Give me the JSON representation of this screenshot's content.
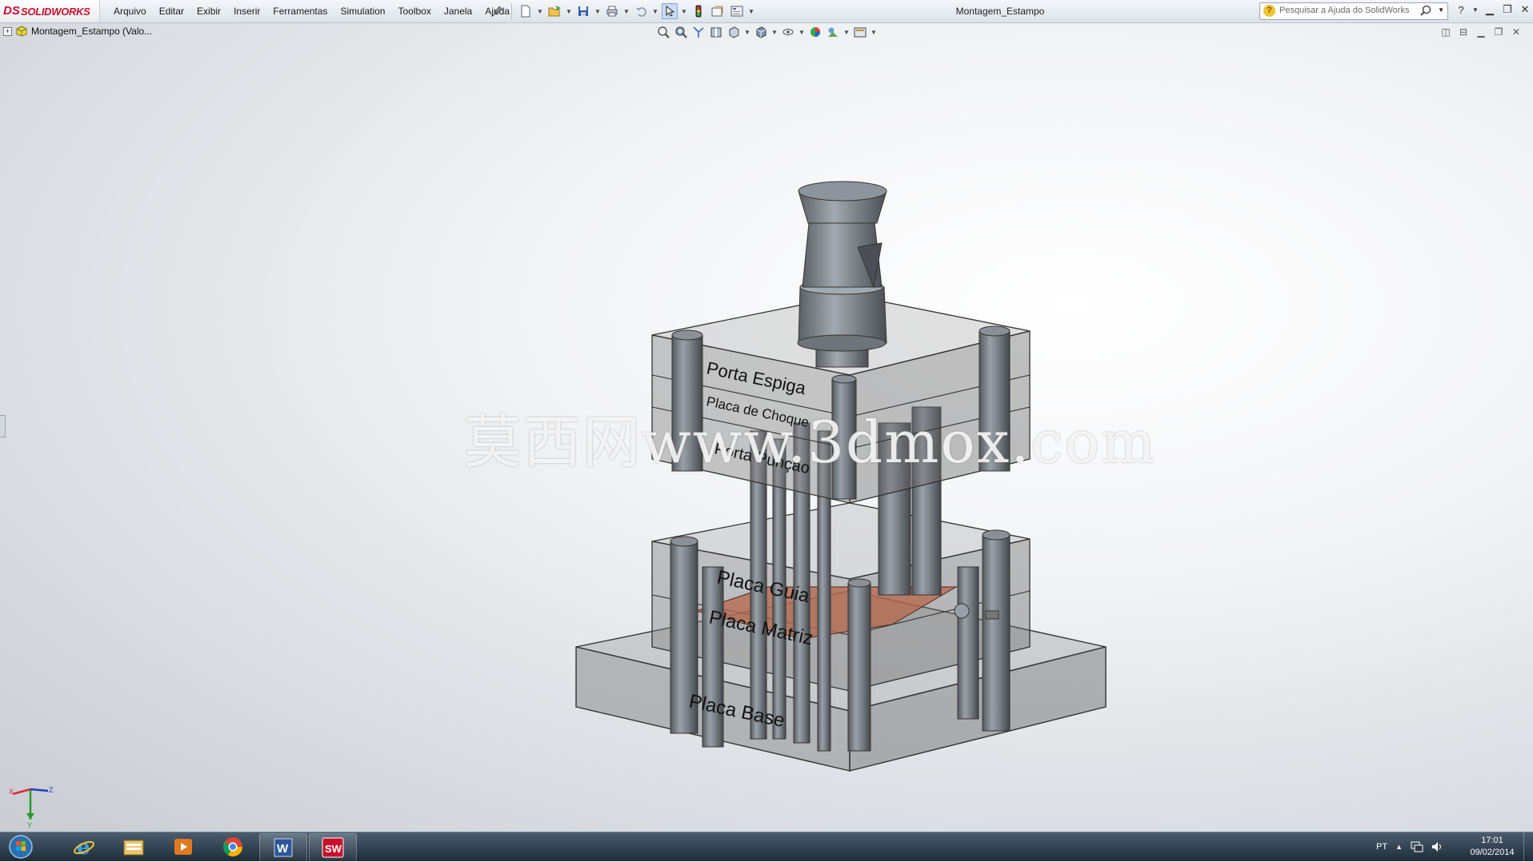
{
  "app": {
    "logo_prefix": "DS",
    "logo_name": "SOLIDWORKS"
  },
  "menu": [
    "Arquivo",
    "Editar",
    "Exibir",
    "Inserir",
    "Ferramentas",
    "Simulation",
    "Toolbox",
    "Janela",
    "Ajuda"
  ],
  "document": {
    "title": "Montagem_Estampo"
  },
  "search": {
    "placeholder": "Pesquisar a Ajuda do SolidWorks"
  },
  "feature_tree": {
    "root_label": "Montagem_Estampo  (Valo..."
  },
  "model_labels": {
    "porta_espiga": "Porta Espiga",
    "placa_choque": "Placa de Choque",
    "porta_puncao": "Porta Punção",
    "placa_guia": "Placa Guia",
    "placa_matriz": "Placa Matriz",
    "placa_base": "Placa Base"
  },
  "watermark": "莫西网www.3dmox.com",
  "triad": {
    "x": "X",
    "y": "Y",
    "z": "Z"
  },
  "taskbar": {
    "apps": [
      "start-orb-icon",
      "internet-explorer-icon",
      "file-explorer-icon",
      "media-player-icon",
      "chrome-icon",
      "word-icon",
      "solidworks-icon"
    ],
    "language": "PT",
    "time": "17:01",
    "date": "09/02/2014"
  },
  "colors": {
    "brand": "#c8102e",
    "plate_copper": "#b5654a",
    "taskbar": "#2a3846"
  }
}
